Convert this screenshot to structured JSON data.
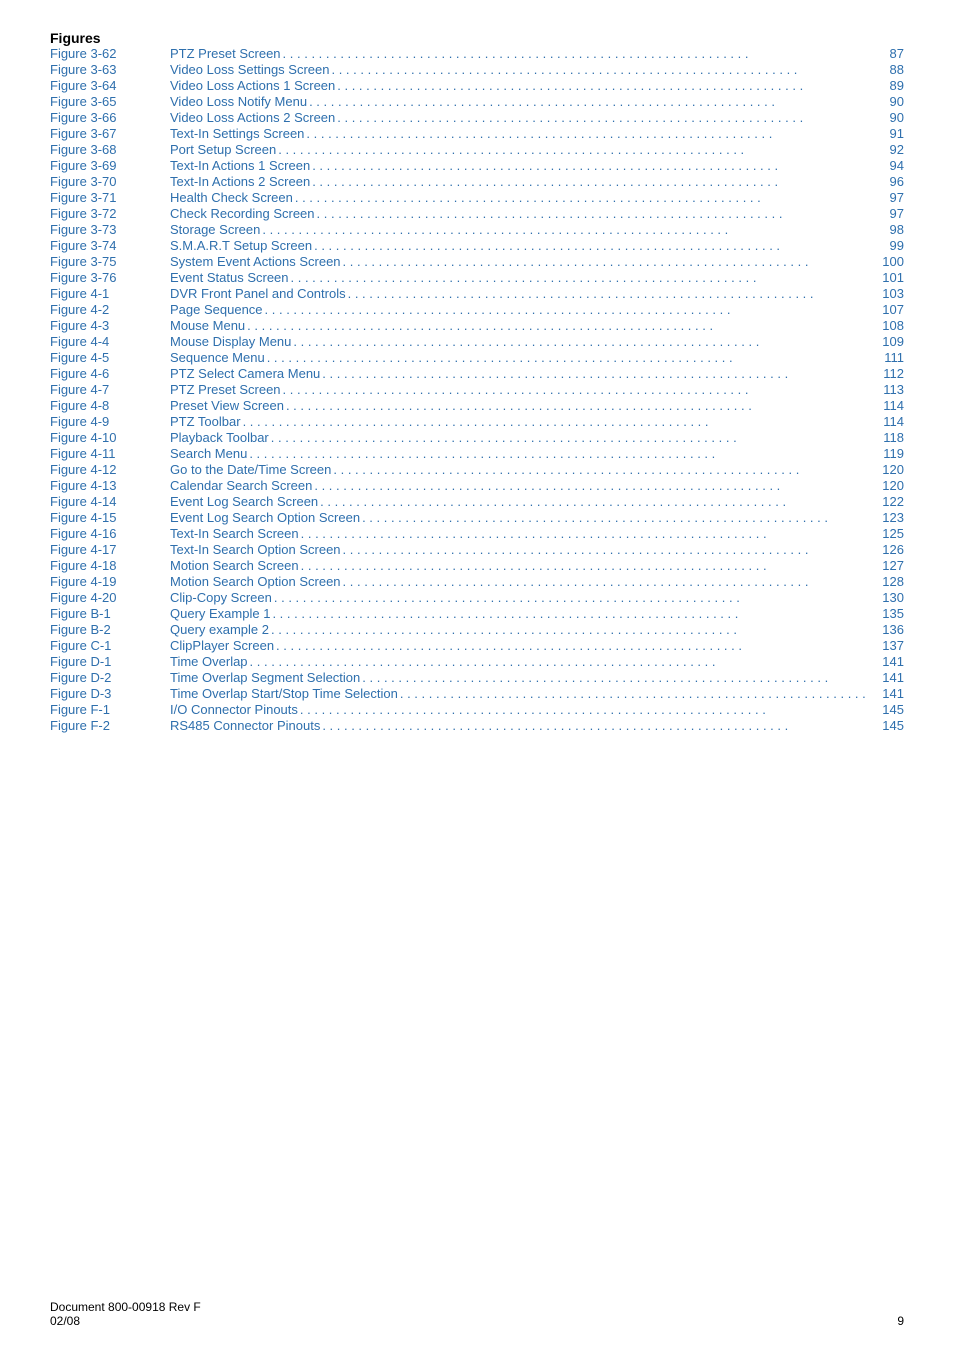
{
  "header": {
    "title": "Figures"
  },
  "entries": [
    {
      "label": "Figure 3-62",
      "title": "PTZ Preset Screen",
      "page": "87"
    },
    {
      "label": "Figure 3-63",
      "title": "Video Loss Settings Screen",
      "page": "88"
    },
    {
      "label": "Figure 3-64",
      "title": "Video Loss Actions 1 Screen",
      "page": "89"
    },
    {
      "label": "Figure 3-65",
      "title": "Video Loss Notify Menu",
      "page": "90"
    },
    {
      "label": "Figure 3-66",
      "title": "Video Loss Actions 2 Screen",
      "page": "90"
    },
    {
      "label": "Figure 3-67",
      "title": "Text-In Settings Screen",
      "page": "91"
    },
    {
      "label": "Figure 3-68",
      "title": "Port Setup Screen",
      "page": "92"
    },
    {
      "label": "Figure 3-69",
      "title": "Text-In Actions 1 Screen",
      "page": "94"
    },
    {
      "label": "Figure 3-70",
      "title": "Text-In Actions 2 Screen",
      "page": "96"
    },
    {
      "label": "Figure 3-71",
      "title": "Health Check Screen",
      "page": "97"
    },
    {
      "label": "Figure 3-72",
      "title": "Check Recording Screen",
      "page": "97"
    },
    {
      "label": "Figure 3-73",
      "title": "Storage Screen",
      "page": "98"
    },
    {
      "label": "Figure 3-74",
      "title": "S.M.A.R.T Setup Screen",
      "page": "99"
    },
    {
      "label": "Figure 3-75",
      "title": "System Event Actions Screen",
      "page": "100"
    },
    {
      "label": "Figure 3-76",
      "title": "Event Status Screen",
      "page": "101"
    },
    {
      "label": "Figure 4-1",
      "title": "DVR Front Panel and Controls",
      "page": "103"
    },
    {
      "label": "Figure 4-2",
      "title": "Page Sequence",
      "page": "107"
    },
    {
      "label": "Figure 4-3",
      "title": "Mouse Menu",
      "page": "108"
    },
    {
      "label": "Figure 4-4",
      "title": "Mouse Display Menu",
      "page": "109"
    },
    {
      "label": "Figure 4-5",
      "title": "Sequence Menu",
      "page": "111"
    },
    {
      "label": "Figure 4-6",
      "title": "PTZ Select Camera Menu",
      "page": "112"
    },
    {
      "label": "Figure 4-7",
      "title": "PTZ Preset Screen",
      "page": "113"
    },
    {
      "label": "Figure 4-8",
      "title": "Preset View Screen",
      "page": "114"
    },
    {
      "label": "Figure 4-9",
      "title": "PTZ Toolbar",
      "page": "114"
    },
    {
      "label": "Figure 4-10",
      "title": "Playback Toolbar",
      "page": "118"
    },
    {
      "label": "Figure 4-11",
      "title": "Search Menu",
      "page": "119"
    },
    {
      "label": "Figure 4-12",
      "title": "Go to the Date/Time Screen",
      "page": "120"
    },
    {
      "label": "Figure 4-13",
      "title": "Calendar Search Screen",
      "page": "120"
    },
    {
      "label": "Figure 4-14",
      "title": "Event Log Search Screen",
      "page": "122"
    },
    {
      "label": "Figure 4-15",
      "title": "Event Log Search Option Screen",
      "page": "123"
    },
    {
      "label": "Figure 4-16",
      "title": "Text-In Search Screen",
      "page": "125"
    },
    {
      "label": "Figure 4-17",
      "title": "Text-In Search Option Screen",
      "page": "126"
    },
    {
      "label": "Figure 4-18",
      "title": "Motion Search Screen",
      "page": "127"
    },
    {
      "label": "Figure 4-19",
      "title": "Motion Search Option Screen",
      "page": "128"
    },
    {
      "label": "Figure 4-20",
      "title": "Clip-Copy Screen",
      "page": "130"
    },
    {
      "label": "Figure B-1",
      "title": "Query Example 1",
      "page": "135"
    },
    {
      "label": "Figure B-2",
      "title": "Query example 2",
      "page": "136"
    },
    {
      "label": "Figure C-1",
      "title": "ClipPlayer Screen",
      "page": "137"
    },
    {
      "label": "Figure D-1",
      "title": "Time Overlap",
      "page": "141"
    },
    {
      "label": "Figure D-2",
      "title": "Time Overlap Segment Selection",
      "page": "141"
    },
    {
      "label": "Figure D-3",
      "title": "Time Overlap Start/Stop Time Selection",
      "page": "141"
    },
    {
      "label": "Figure F-1",
      "title": "I/O Connector Pinouts",
      "page": "145"
    },
    {
      "label": "Figure F-2",
      "title": "RS485 Connector Pinouts",
      "page": "145"
    }
  ],
  "footer": {
    "doc_id": "Document 800-00918 Rev F",
    "date": "02/08",
    "page_number": "9"
  }
}
